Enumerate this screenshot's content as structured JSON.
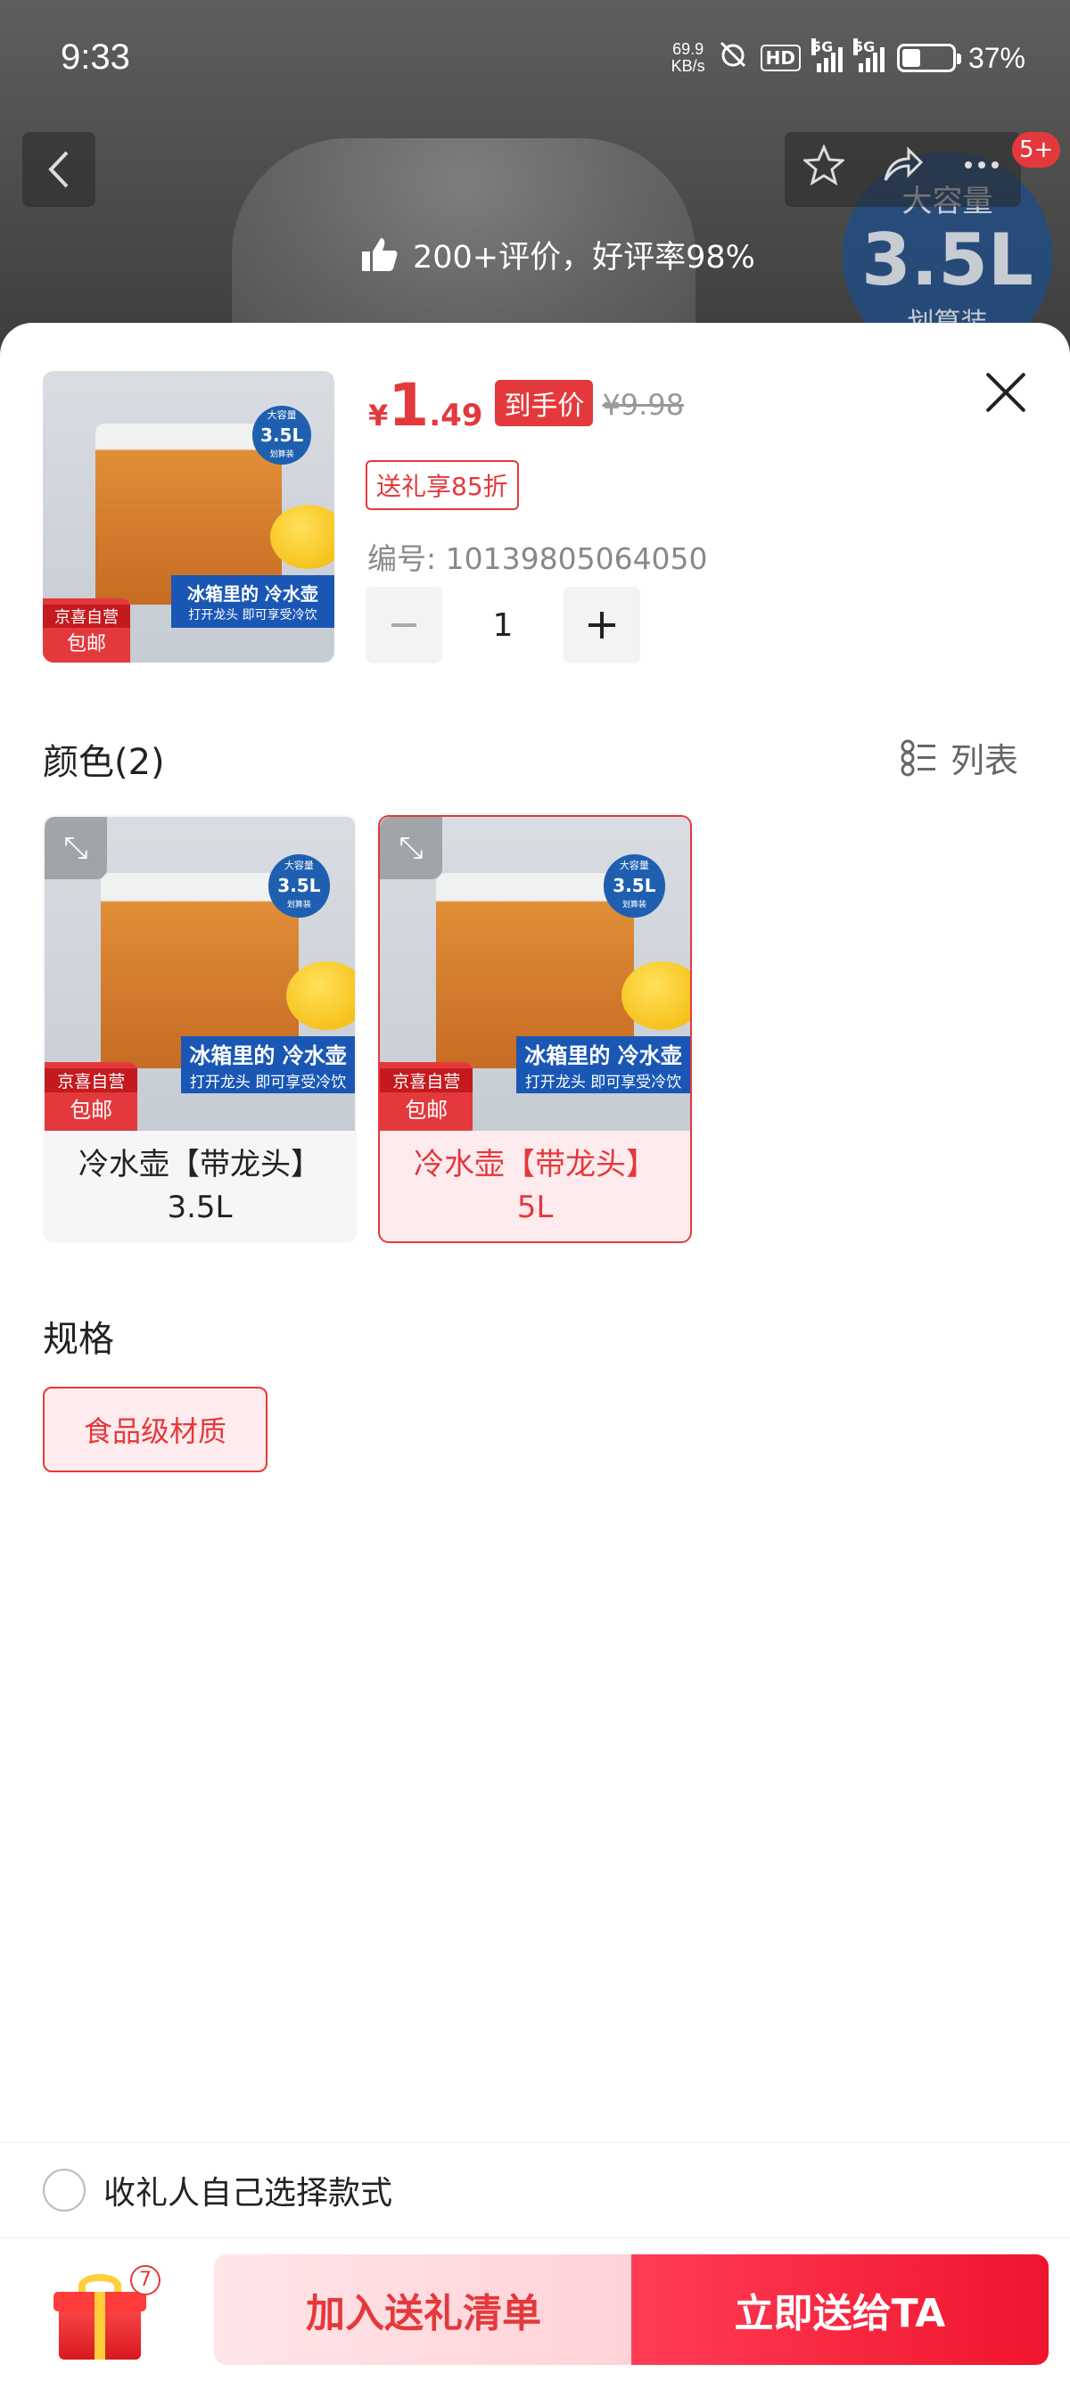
{
  "status_bar": {
    "time": "9:33",
    "net_speed_value": "69.9",
    "net_speed_unit": "KB/s",
    "hd_label": "HD",
    "signal_label_1": "5G",
    "signal_label_2": "5G",
    "battery_percent": 37,
    "battery_text": "37%"
  },
  "background_page": {
    "badge_line1": "大容量",
    "badge_line2": "3.5L",
    "badge_line3": "划算装",
    "message_count": "5+",
    "review_summary": "200+评价，好评率98%"
  },
  "product": {
    "price_currency": "¥",
    "price_int": "1",
    "price_dec": ".49",
    "price_label": "到手价",
    "original_price": "¥9.98",
    "promo_tag": "送礼享85折",
    "sku": "编号: 10139805064050",
    "quantity": "1",
    "image_badge_top": "大容量",
    "image_badge_size": "3.5L",
    "image_badge_bottom": "划算装",
    "image_banner_title": "冰箱里的 冷水壶",
    "image_banner_sub": "打开龙头 即可享受冷饮",
    "image_tag_top": "京喜自营",
    "image_tag_bottom": "包邮"
  },
  "color_section": {
    "title": "颜色(2)",
    "list_toggle_label": "列表",
    "variants": [
      {
        "line1": "冷水壶【带龙头】",
        "line2": "3.5L",
        "selected": false
      },
      {
        "line1": "冷水壶【带龙头】",
        "line2": "5L",
        "selected": true
      }
    ]
  },
  "spec_section": {
    "title": "规格",
    "option": "食品级材质"
  },
  "gift_option": {
    "label": "收礼人自己选择款式"
  },
  "bottom_bar": {
    "gift_count": "7",
    "add_list_label": "加入送礼清单",
    "send_now_label": "立即送给TA"
  },
  "icons": {
    "back": "chevron-left-icon",
    "favorite": "star-icon",
    "share": "share-icon",
    "more": "more-icon",
    "close": "close-icon",
    "list": "list-icon",
    "expand": "expand-icon",
    "gift": "gift-icon",
    "thumb": "thumbs-up-icon"
  },
  "colors": {
    "accent_red": "#e4393c",
    "selected_bg": "#fdebed",
    "blue_banner": "#1a57b5"
  }
}
